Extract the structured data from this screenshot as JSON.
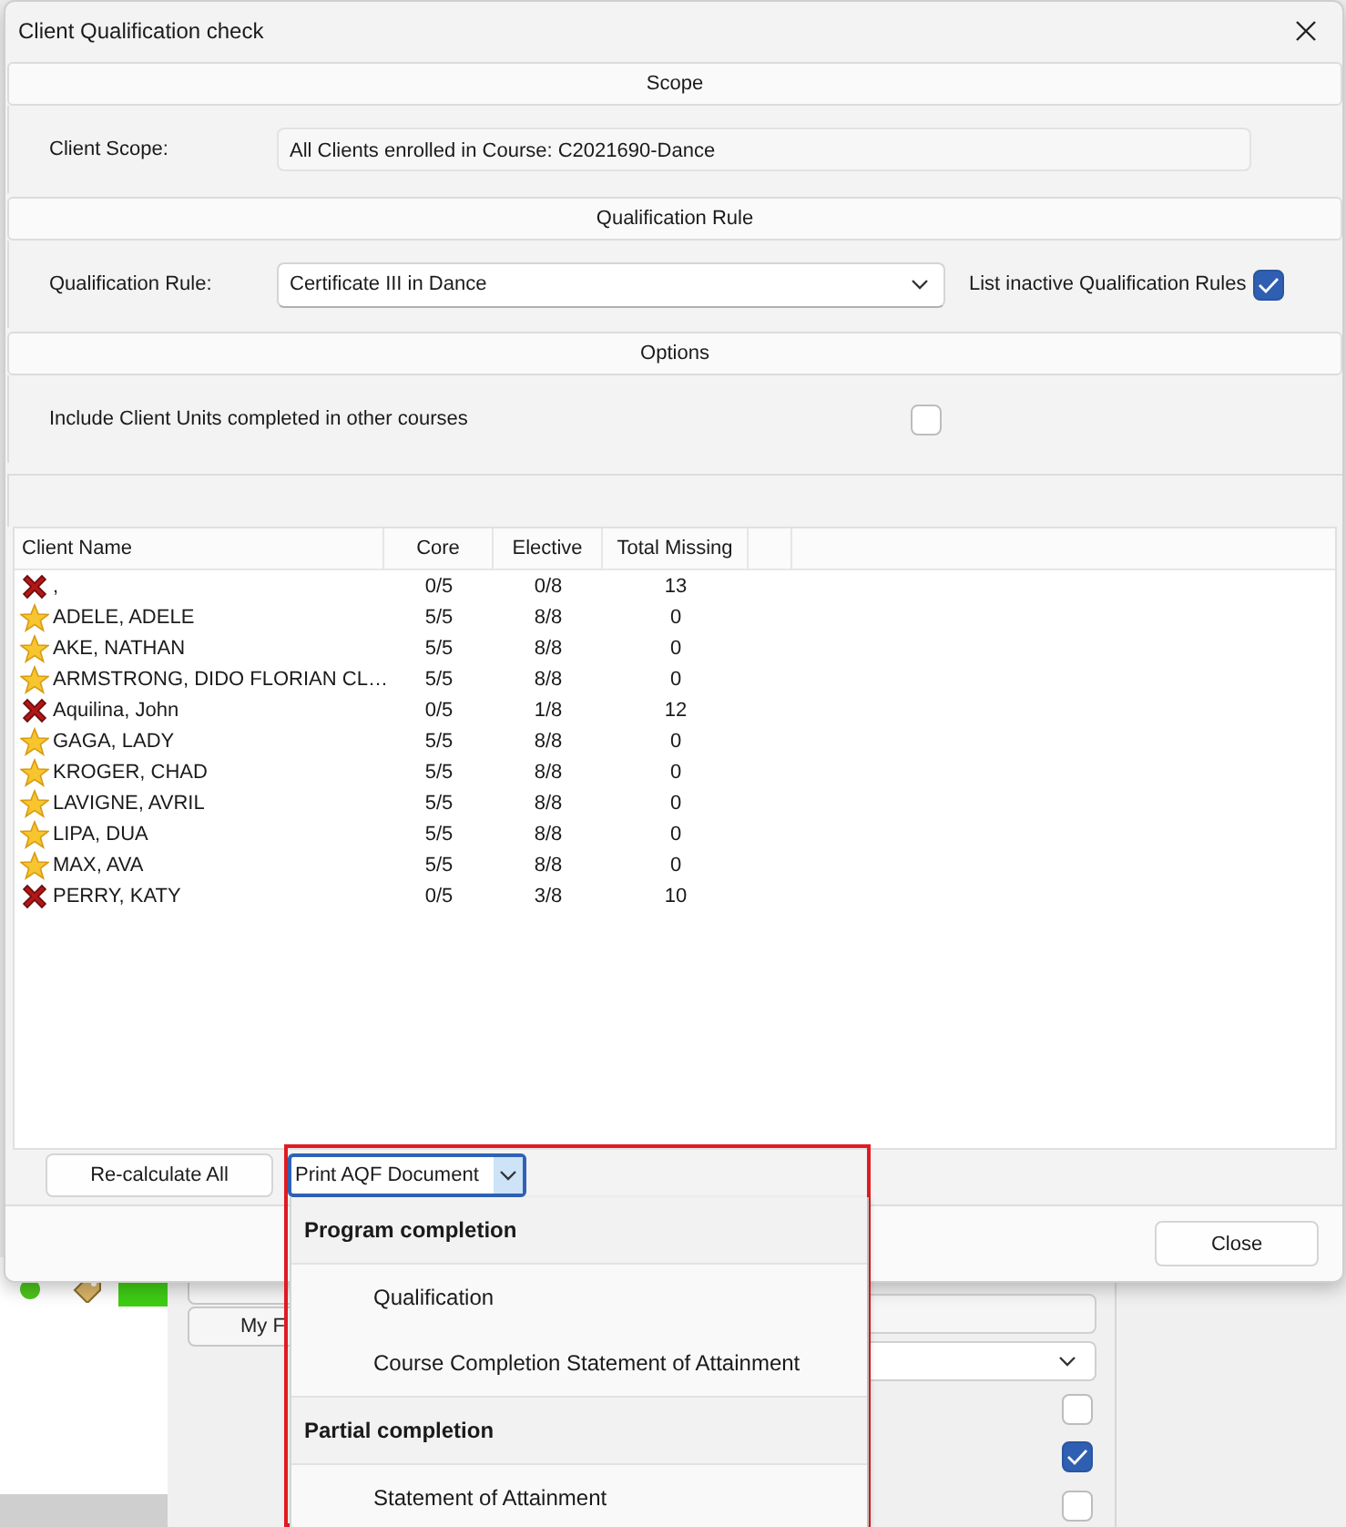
{
  "dialog": {
    "title": "Client Qualification check"
  },
  "scope": {
    "header": "Scope",
    "label": "Client Scope:",
    "value": "All Clients enrolled in Course: C2021690-Dance"
  },
  "qualification": {
    "header": "Qualification Rule",
    "label": "Qualification Rule:",
    "value": "Certificate III in Dance",
    "inactive_label": "List inactive Qualification Rules",
    "inactive_checked": true
  },
  "options": {
    "header": "Options",
    "label": "Include Client Units completed in other courses",
    "checked": false
  },
  "table": {
    "columns": [
      "Client Name",
      "Core",
      "Elective",
      "Total Missing"
    ],
    "rows": [
      {
        "kind": "failed",
        "name": ",",
        "core": "0/5",
        "elective": "0/8",
        "missing": "13"
      },
      {
        "kind": "passed",
        "name": "ADELE, ADELE",
        "core": "5/5",
        "elective": "8/8",
        "missing": "0"
      },
      {
        "kind": "passed",
        "name": "AKE, NATHAN",
        "core": "5/5",
        "elective": "8/8",
        "missing": "0"
      },
      {
        "kind": "passed",
        "name": "ARMSTRONG, DIDO FLORIAN CL…",
        "core": "5/5",
        "elective": "8/8",
        "missing": "0"
      },
      {
        "kind": "failed",
        "name": "Aquilina, John",
        "core": "0/5",
        "elective": "1/8",
        "missing": "12"
      },
      {
        "kind": "passed",
        "name": "GAGA, LADY",
        "core": "5/5",
        "elective": "8/8",
        "missing": "0"
      },
      {
        "kind": "passed",
        "name": "KROGER, CHAD",
        "core": "5/5",
        "elective": "8/8",
        "missing": "0"
      },
      {
        "kind": "passed",
        "name": "LAVIGNE, AVRIL",
        "core": "5/5",
        "elective": "8/8",
        "missing": "0"
      },
      {
        "kind": "passed",
        "name": "LIPA, DUA",
        "core": "5/5",
        "elective": "8/8",
        "missing": "0"
      },
      {
        "kind": "passed",
        "name": "MAX, AVA",
        "core": "5/5",
        "elective": "8/8",
        "missing": "0"
      },
      {
        "kind": "failed",
        "name": "PERRY, KATY",
        "core": "0/5",
        "elective": "3/8",
        "missing": "10"
      }
    ]
  },
  "buttons": {
    "recalculate": "Re-calculate All",
    "close": "Close"
  },
  "print_dropdown": {
    "label": "Print AQF Document",
    "expanded": true,
    "menu": [
      {
        "kind": "header",
        "label": "Program completion"
      },
      {
        "kind": "item",
        "label": "Qualification"
      },
      {
        "kind": "item",
        "label": "Course Completion Statement of Attainment"
      },
      {
        "kind": "header",
        "label": "Partial completion"
      },
      {
        "kind": "item",
        "label": "Statement of Attainment"
      }
    ]
  },
  "background": {
    "tab_label": "My F",
    "checkboxes": [
      {
        "checked": false
      },
      {
        "checked": true
      },
      {
        "checked": false
      }
    ]
  }
}
